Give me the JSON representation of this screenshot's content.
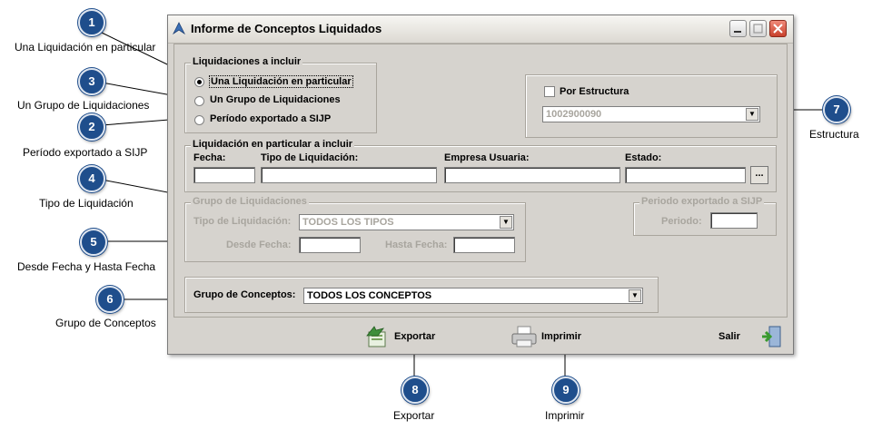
{
  "window": {
    "title": "Informe de Conceptos Liquidados"
  },
  "liquidaciones": {
    "legend": "Liquidaciones a incluir",
    "options": [
      {
        "label": "Una Liquidación en particular",
        "selected": true
      },
      {
        "label": "Un Grupo de Liquidaciones",
        "selected": false
      },
      {
        "label": "Período exportado a SIJP",
        "selected": false
      }
    ]
  },
  "estructura": {
    "checkbox_label": "Por Estructura",
    "checked": false,
    "value": "1002900090"
  },
  "particular": {
    "legend": "Liquidación en particular a incluir",
    "fecha_label": "Fecha:",
    "tipo_label": "Tipo de Liquidación:",
    "empresa_label": "Empresa Usuaria:",
    "estado_label": "Estado:",
    "browse_label": "..."
  },
  "grupo_liq": {
    "legend": "Grupo de Liquidaciones",
    "tipo_label": "Tipo de Liquidación:",
    "tipo_value": "TODOS LOS TIPOS",
    "desde_label": "Desde Fecha:",
    "hasta_label": "Hasta Fecha:"
  },
  "periodo": {
    "legend": "Periodo exportado a SIJP",
    "periodo_label": "Periodo:"
  },
  "conceptos": {
    "label": "Grupo de Conceptos:",
    "value": "TODOS LOS CONCEPTOS"
  },
  "actions": {
    "exportar": "Exportar",
    "imprimir": "Imprimir",
    "salir": "Salir"
  },
  "callouts": [
    {
      "num": "1",
      "caption": "Una Liquidación en particular"
    },
    {
      "num": "3",
      "caption": "Un Grupo de Liquidaciones"
    },
    {
      "num": "2",
      "caption": "Período exportado a SIJP"
    },
    {
      "num": "4",
      "caption": "Tipo de Liquidación"
    },
    {
      "num": "5",
      "caption": "Desde Fecha y Hasta Fecha"
    },
    {
      "num": "6",
      "caption": "Grupo de Conceptos"
    },
    {
      "num": "7",
      "caption": "Estructura"
    },
    {
      "num": "8",
      "caption": "Exportar"
    },
    {
      "num": "9",
      "caption": "Imprimir"
    }
  ],
  "colors": {
    "badge": "#1f4e8c",
    "window_bg": "#d6d3ce",
    "disabled_text": "#a8a59e"
  }
}
